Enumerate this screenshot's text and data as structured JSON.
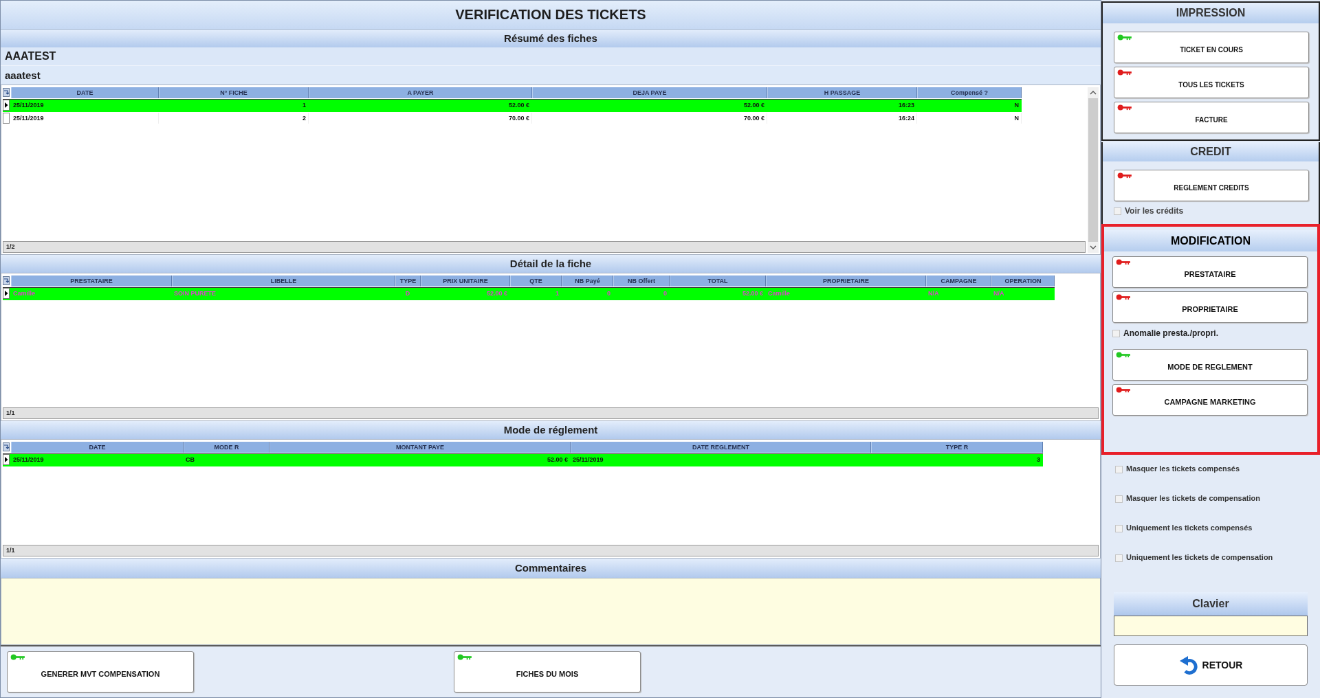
{
  "title": "VERIFICATION DES TICKETS",
  "summary": {
    "heading": "Résumé des fiches",
    "client_code": "AAATEST",
    "client_name": "aaatest",
    "table": {
      "columns": [
        {
          "label": "DATE",
          "kind": "text"
        },
        {
          "label": "N° FICHE",
          "kind": "number"
        },
        {
          "label": "A PAYER",
          "kind": "number"
        },
        {
          "label": "DEJA PAYE",
          "kind": "number"
        },
        {
          "label": "H PASSAGE",
          "kind": "number"
        },
        {
          "label": "Compensé ?",
          "kind": "flag"
        }
      ],
      "rows": [
        {
          "selected": true,
          "cells": [
            "25/11/2019",
            "1",
            "52.00 €",
            "52.00 €",
            "16:23",
            "N"
          ]
        },
        {
          "selected": false,
          "cells": [
            "25/11/2019",
            "2",
            "70.00 €",
            "70.00 €",
            "16:24",
            "N"
          ]
        }
      ],
      "footer": "1/2"
    }
  },
  "detail": {
    "heading": "Détail de la fiche",
    "table": {
      "columns": [
        {
          "label": "PRESTATAIRE",
          "kind": "text"
        },
        {
          "label": "LIBELLE",
          "kind": "text"
        },
        {
          "label": "TYPE",
          "kind": "code"
        },
        {
          "label": "PRIX UNITAIRE",
          "kind": "number"
        },
        {
          "label": "QTE",
          "kind": "number"
        },
        {
          "label": "NB Payé",
          "kind": "number"
        },
        {
          "label": "NB Offert",
          "kind": "number"
        },
        {
          "label": "TOTAL",
          "kind": "number"
        },
        {
          "label": "PROPRIETAIRE",
          "kind": "text"
        },
        {
          "label": "CAMPAGNE",
          "kind": "text"
        },
        {
          "label": "OPERATION",
          "kind": "text"
        }
      ],
      "rows": [
        {
          "selected": true,
          "cells": [
            "Camille",
            "SOIN PURETE",
            "D",
            "52.00 €",
            "1",
            "0",
            "0",
            "52.00 €",
            "Camille",
            "N/A",
            "N/A"
          ]
        }
      ],
      "footer": "1/1"
    }
  },
  "payment": {
    "heading": "Mode de réglement",
    "table": {
      "columns": [
        {
          "label": "DATE",
          "kind": "text"
        },
        {
          "label": "MODE R",
          "kind": "text"
        },
        {
          "label": "MONTANT PAYE",
          "kind": "number"
        },
        {
          "label": "DATE REGLEMENT",
          "kind": "text"
        },
        {
          "label": "TYPE R",
          "kind": "number"
        }
      ],
      "rows": [
        {
          "selected": true,
          "cells": [
            "25/11/2019",
            "CB",
            "52.00 €",
            "25/11/2019",
            "3"
          ]
        }
      ],
      "footer": "1/1"
    }
  },
  "comments": {
    "heading": "Commentaires"
  },
  "bottom_buttons": [
    {
      "label": "GENERER MVT COMPENSATION",
      "color": "#22c822"
    },
    {
      "label": "FICHES DU MOIS",
      "color": "#22c822"
    }
  ],
  "side": {
    "panels": [
      {
        "heading": "IMPRESSION",
        "highlighted": false,
        "items": [
          {
            "kind": "button",
            "label": "TICKET EN COURS",
            "color": "#22c822"
          },
          {
            "kind": "button",
            "label": "TOUS LES TICKETS",
            "color": "#e01c1c"
          },
          {
            "kind": "button",
            "label": "FACTURE",
            "color": "#e01c1c"
          }
        ]
      },
      {
        "heading": "CREDIT",
        "highlighted": false,
        "items": [
          {
            "kind": "button",
            "label": "REGLEMENT CREDITS",
            "color": "#e01c1c"
          },
          {
            "kind": "checkbox",
            "label": "Voir les crédits",
            "checked": false
          }
        ]
      },
      {
        "heading": "MODIFICATION",
        "highlighted": true,
        "items": [
          {
            "kind": "button",
            "label": "PRESTATAIRE",
            "color": "#e01c1c"
          },
          {
            "kind": "button",
            "label": "PROPRIETAIRE",
            "color": "#e01c1c"
          },
          {
            "kind": "checkbox",
            "label": "Anomalie presta./propri.",
            "checked": false
          },
          {
            "kind": "button",
            "label": "MODE DE REGLEMENT",
            "color": "#22c822"
          },
          {
            "kind": "button",
            "label": "CAMPAGNE MARKETING",
            "color": "#e01c1c"
          }
        ]
      }
    ],
    "filters": [
      {
        "label": "Masquer les tickets compensés",
        "checked": false
      },
      {
        "label": "Masquer les tickets de compensation",
        "checked": false
      },
      {
        "label": "Uniquement les tickets compensés",
        "checked": false
      },
      {
        "label": "Uniquement les tickets de compensation",
        "checked": false
      }
    ],
    "keyboard": {
      "heading": "Clavier"
    },
    "back_button": {
      "label": "RETOUR"
    }
  }
}
